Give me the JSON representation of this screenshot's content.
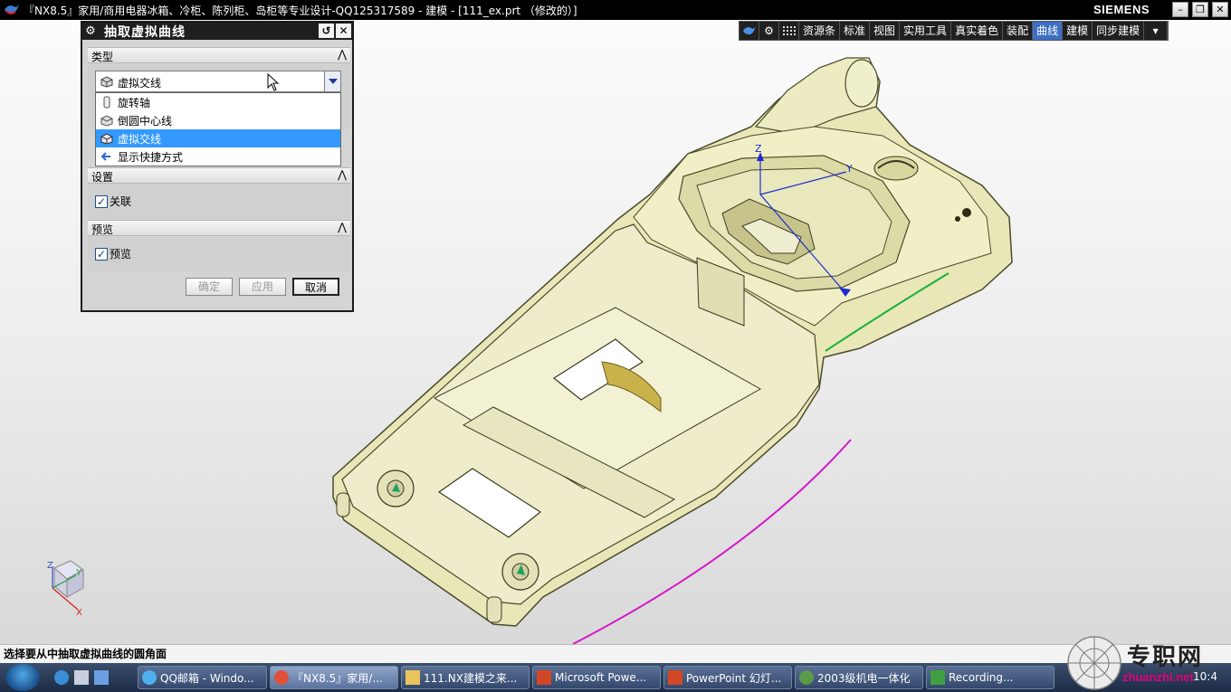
{
  "window": {
    "title": "『NX8.5』家用/商用电器冰箱、冷柜、陈列柜、岛柜等专业设计-QQ125317589 - 建模 - [111_ex.prt （修改的）]",
    "brand": "SIEMENS",
    "minimize_glyph": "–",
    "restore_glyph": "❐",
    "close_glyph": "✕"
  },
  "toolbar": {
    "items": [
      "资源条",
      "标准",
      "视图",
      "实用工具",
      "真实着色",
      "装配",
      "曲线",
      "建模",
      "同步建模"
    ],
    "active": "曲线",
    "overflow_glyph": "▾"
  },
  "dialog": {
    "title": "抽取虚拟曲线",
    "reset_glyph": "↺",
    "close_glyph": "✕",
    "section_type": "类型",
    "combo_value": "虚拟交线",
    "dropdown": [
      {
        "label": "旋转轴",
        "selected": false,
        "icon": "rotate-axis-icon"
      },
      {
        "label": "倒圆中心线",
        "selected": false,
        "icon": "blend-center-icon"
      },
      {
        "label": "虚拟交线",
        "selected": true,
        "icon": "virtual-intersection-icon"
      },
      {
        "label": "显示快捷方式",
        "selected": false,
        "icon": "shortcut-arrow-icon"
      }
    ],
    "section_settings": "设置",
    "associative_label": "关联",
    "section_preview": "预览",
    "preview_label": "预览",
    "collapse_glyph": "⋀",
    "ok": "确定",
    "apply": "应用",
    "cancel": "取消"
  },
  "viewport": {
    "axis_x": "X",
    "axis_y": "Y",
    "axis_z": "Z"
  },
  "status": "选择要从中抽取虚拟曲线的圆角面",
  "taskbar": {
    "tasks": [
      {
        "label": "QQ邮箱 - Windo...",
        "active": false
      },
      {
        "label": "『NX8.5』家用/...",
        "active": true
      },
      {
        "label": "111.NX建模之来...",
        "active": false
      },
      {
        "label": "Microsoft Powe...",
        "active": false
      },
      {
        "label": "PowerPoint 幻灯...",
        "active": false
      },
      {
        "label": "2003级机电一体化",
        "active": false
      },
      {
        "label": "Recording...",
        "active": false
      }
    ],
    "clock": "10:4"
  },
  "watermark": {
    "text": "专职网",
    "sub": "zhuanzhi.net"
  }
}
